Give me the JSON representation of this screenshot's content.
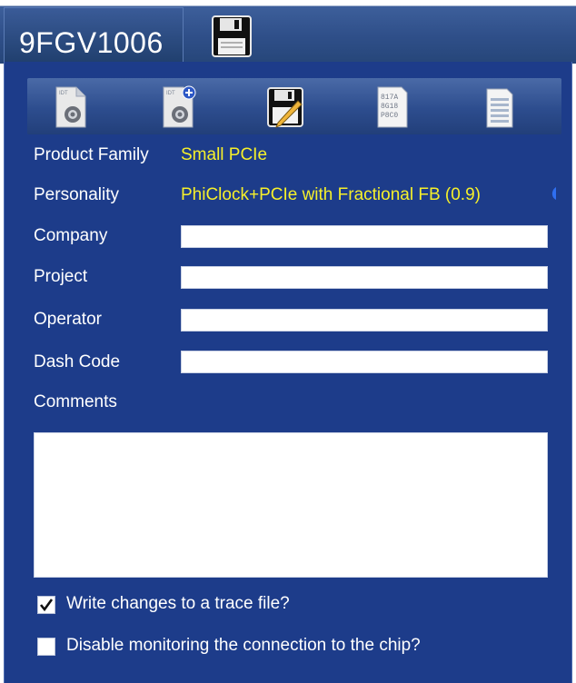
{
  "header": {
    "title": "9FGV1006",
    "save_icon": "floppy-disk-icon"
  },
  "toolbar": {
    "buttons": [
      {
        "name": "settings-document-icon"
      },
      {
        "name": "add-settings-document-icon"
      },
      {
        "name": "save-edit-icon"
      },
      {
        "name": "hex-data-document-icon"
      },
      {
        "name": "document-list-icon"
      }
    ]
  },
  "form": {
    "product_family_label": "Product Family",
    "product_family_value": "Small PCIe",
    "personality_label": "Personality",
    "personality_value": "PhiClock+PCIe with Fractional FB (0.9)",
    "company_label": "Company",
    "company_value": "",
    "project_label": "Project",
    "project_value": "",
    "operator_label": "Operator",
    "operator_value": "",
    "dash_code_label": "Dash Code",
    "dash_code_value": "",
    "comments_label": "Comments",
    "comments_value": ""
  },
  "options": {
    "trace_label": "Write changes to a trace file?",
    "trace_checked": true,
    "monitor_label": "Disable monitoring the connection to the chip?",
    "monitor_checked": false
  },
  "colors": {
    "panel": "#1d3c8a",
    "value_text": "#f6f02a",
    "label_text": "#ffffff"
  }
}
